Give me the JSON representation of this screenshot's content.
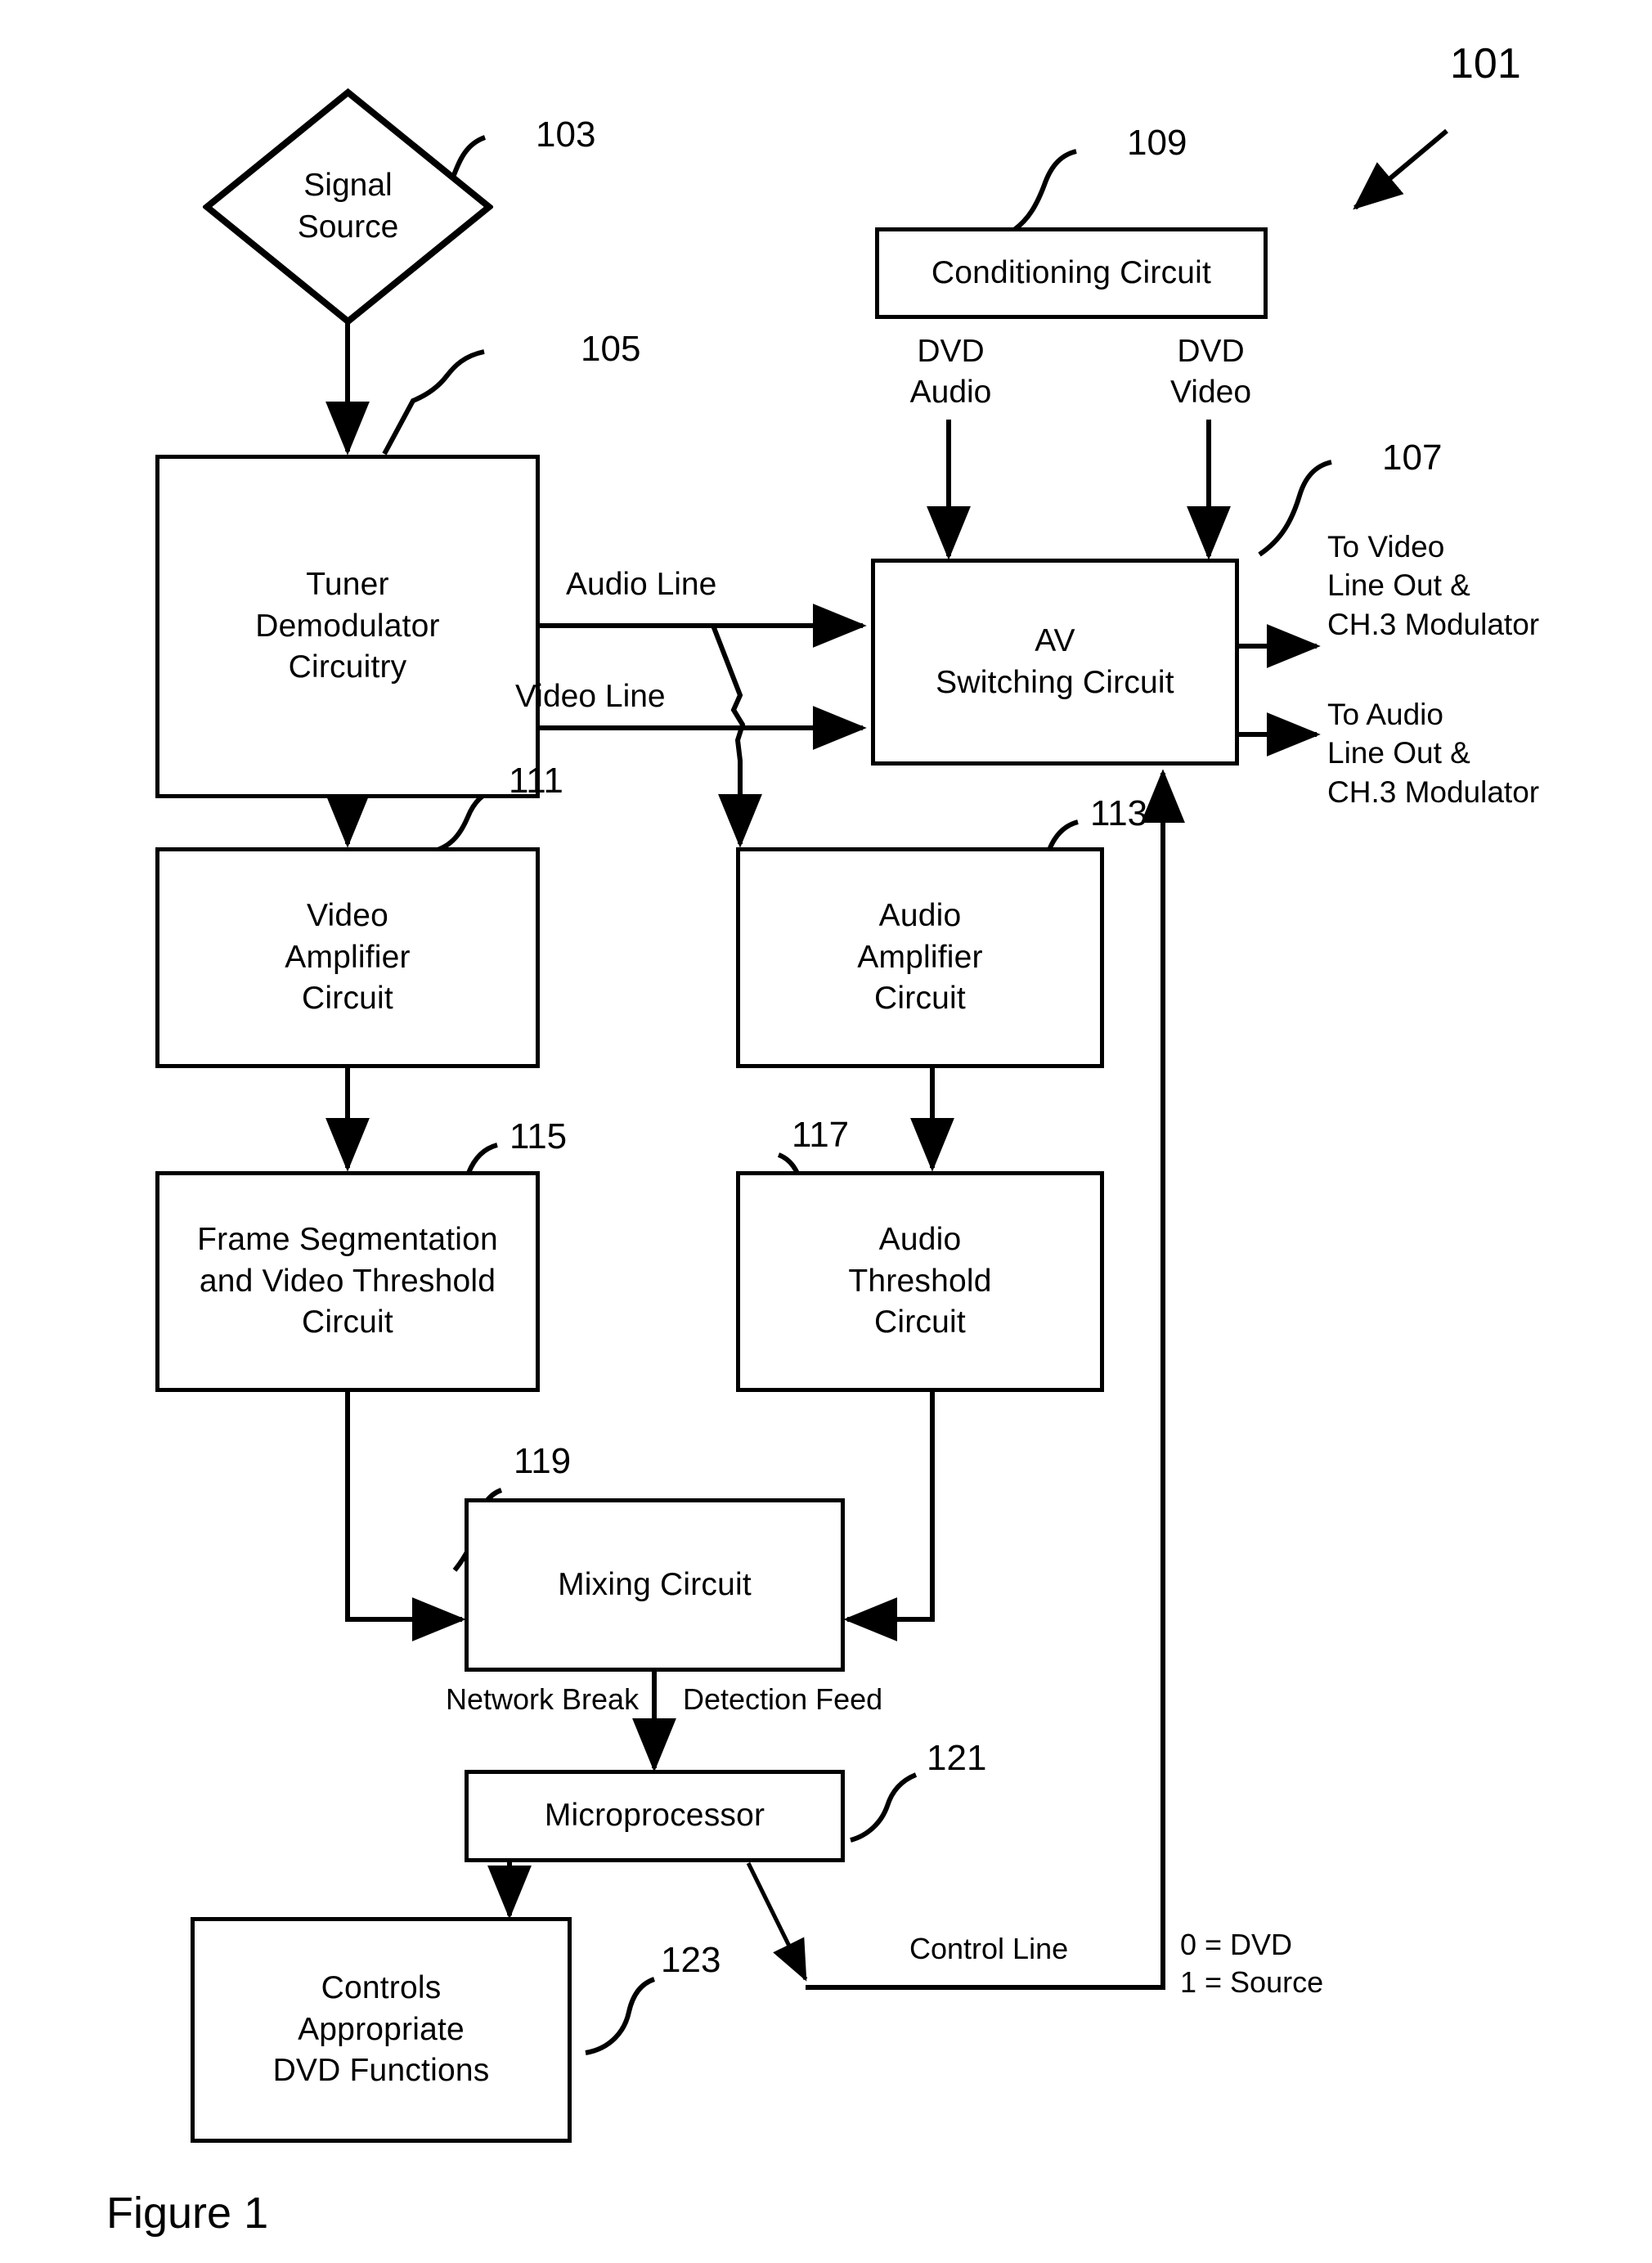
{
  "figure": {
    "caption": "Figure 1",
    "system_ref": "101"
  },
  "nodes": {
    "signal_source": {
      "label": "Signal\nSource",
      "ref": "103"
    },
    "tuner": {
      "label": "Tuner\nDemodulator\nCircuitry",
      "ref": "105"
    },
    "conditioning": {
      "label": "Conditioning Circuit",
      "ref": "109"
    },
    "av_switching": {
      "label": "AV\nSwitching Circuit",
      "ref": "107"
    },
    "video_amplifier": {
      "label": "Video\nAmplifier\nCircuit",
      "ref": "111"
    },
    "audio_amplifier": {
      "label": "Audio\nAmplifier\nCircuit",
      "ref": "113"
    },
    "frame_segmentation": {
      "label": "Frame Segmentation\nand Video Threshold\nCircuit",
      "ref": "115"
    },
    "audio_threshold": {
      "label": "Audio\nThreshold\nCircuit",
      "ref": "117"
    },
    "mixing": {
      "label": "Mixing Circuit",
      "ref": "119"
    },
    "microprocessor": {
      "label": "Microprocessor",
      "ref": "121"
    },
    "controls_dvd": {
      "label": "Controls\nAppropriate\nDVD Functions",
      "ref": "123"
    }
  },
  "edge_labels": {
    "audio_line": "Audio Line",
    "video_line": "Video Line",
    "dvd_audio": "DVD\nAudio",
    "dvd_video": "DVD\nVideo",
    "to_video_out": "To Video\nLine Out &\nCH.3 Modulator",
    "to_audio_out": "To Audio\nLine Out &\nCH.3 Modulator",
    "network_break": "Network Break",
    "detection_feed": "Detection Feed",
    "control_line": "Control Line",
    "control_legend": "0 = DVD\n1 = Source"
  },
  "style": {
    "ink": "#000000",
    "paper": "#ffffff"
  }
}
